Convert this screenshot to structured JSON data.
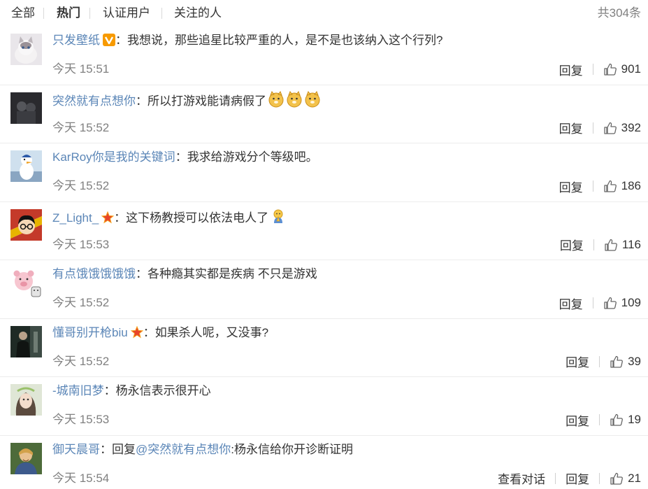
{
  "tabs": [
    {
      "label": "全部"
    },
    {
      "label": "热门"
    },
    {
      "label": "认证用户"
    },
    {
      "label": "关注的人"
    }
  ],
  "total": "共304条",
  "reply_label": "回复",
  "dialog_label": "查看对话",
  "comments": [
    {
      "user": "只发壁纸",
      "badge": "v",
      "colon": "：",
      "text": "我想说，那些追星比较严重的人，是不是也该纳入这个行列?",
      "time": "今天 15:51",
      "likes": "901"
    },
    {
      "user": "突然就有点想你",
      "colon": "：",
      "text": "所以打游戏能请病假了",
      "emoji": "doge-icon",
      "time": "今天 15:52",
      "likes": "392"
    },
    {
      "user": "KarRoy你是我的关键词",
      "colon": "：",
      "text": "我求给游戏分个等级吧。",
      "time": "今天 15:52",
      "likes": "186"
    },
    {
      "user": "Z_Light_",
      "badge": "star",
      "colon": "：",
      "text": "这下杨教授可以依法电人了",
      "emoji": "pray-icon",
      "time": "今天 15:53",
      "likes": "116"
    },
    {
      "user": "有点饿饿饿饿饿",
      "colon": "：",
      "text": "各种瘾其实都是疾病 不只是游戏",
      "time": "今天 15:52",
      "likes": "109"
    },
    {
      "user": "懂哥别开枪biu",
      "badge": "star",
      "colon": "：",
      "text": "如果杀人呢，又没事?",
      "time": "今天 15:52",
      "likes": "39"
    },
    {
      "user": "-城南旧梦",
      "colon": "：",
      "text": "杨永信表示很开心",
      "time": "今天 15:53",
      "likes": "19"
    },
    {
      "user": "御天晨哥",
      "colon": "：",
      "text_prefix": "回复",
      "mention": "@突然就有点想你",
      "text": ":杨永信给你开诊断证明",
      "time": "今天 15:54",
      "likes": "21",
      "show_dialog": true
    }
  ]
}
